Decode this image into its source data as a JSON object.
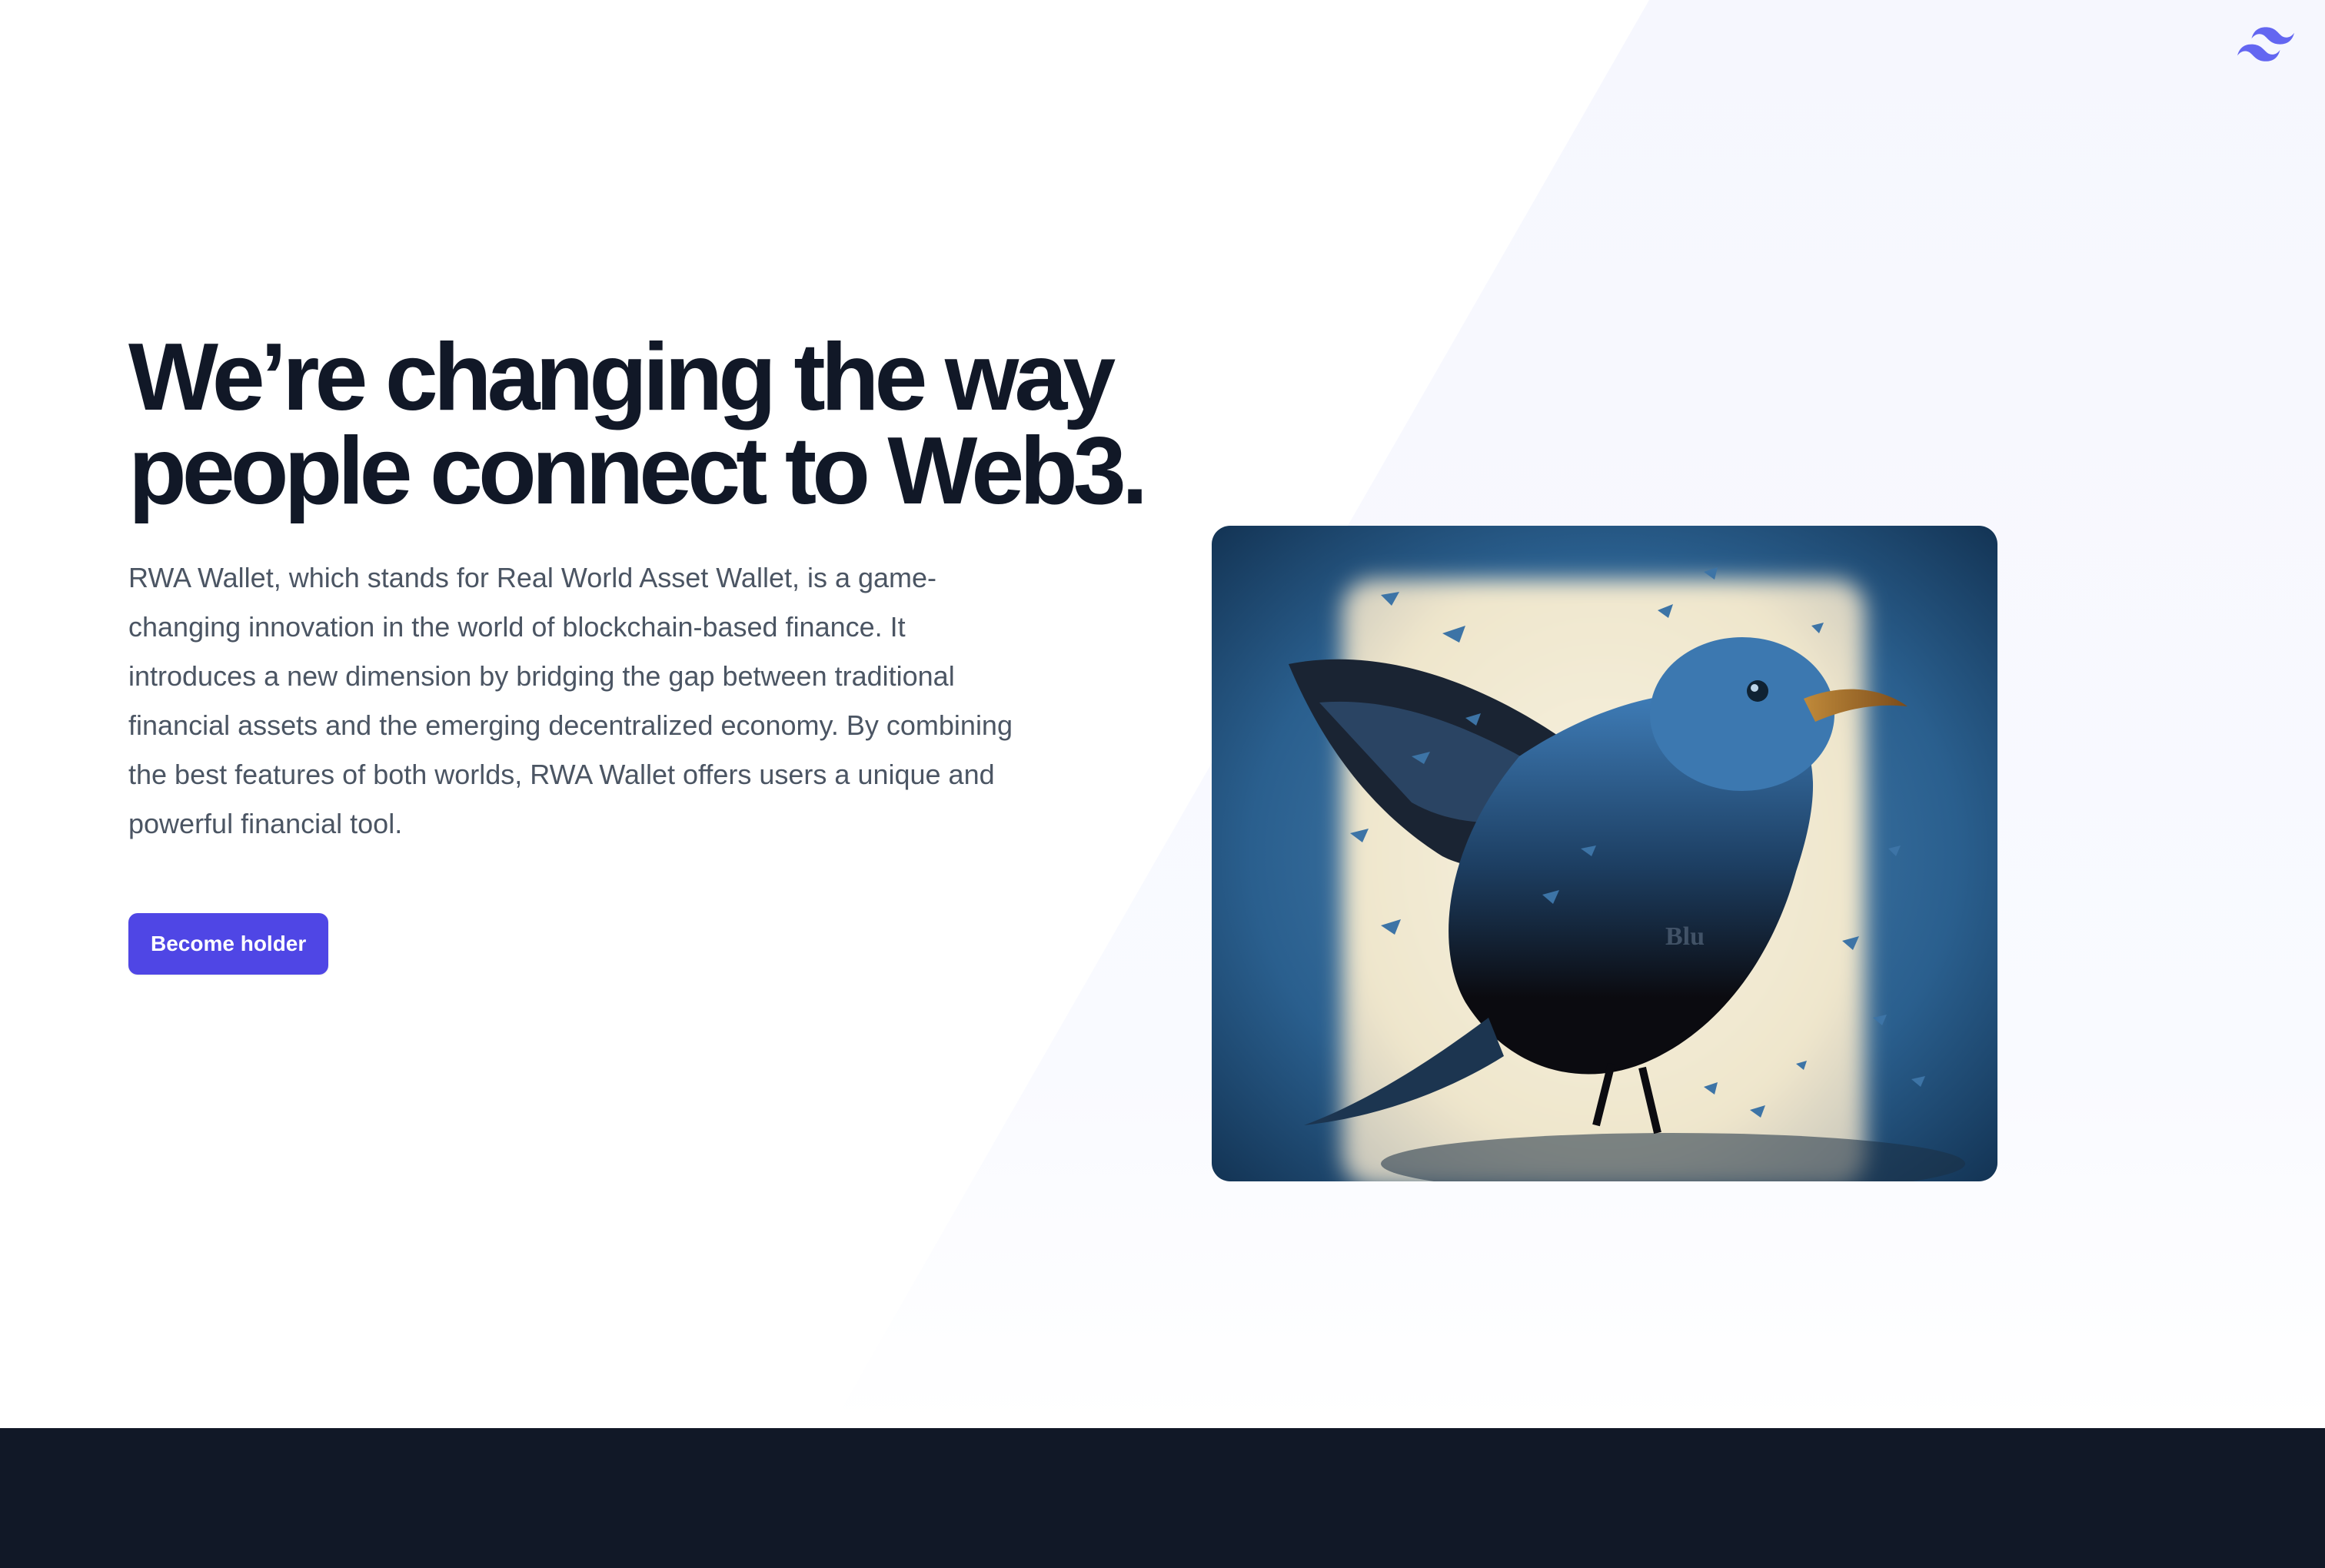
{
  "hero": {
    "headline_line1": "We’re changing the way",
    "headline_line2": "people connect to Web3.",
    "description": "RWA Wallet, which stands for Real World Asset Wallet, is a game-changing innovation in the world of blockchain-based finance. It introduces a new dimension by bridging the gap between traditional financial assets and the emerging decentralized economy. By combining the best features of both worlds, RWA Wallet offers users a unique and powerful financial tool.",
    "cta_label": "Become holder",
    "image_label": "Blu"
  },
  "logo": {
    "icon": "tailwind-wave-logo-icon"
  },
  "colors": {
    "accent": "#4f46e5",
    "heading": "#111827",
    "body_text": "#4b5563",
    "footer_bg": "#111827",
    "slant_bg": "#f8f9fe"
  }
}
